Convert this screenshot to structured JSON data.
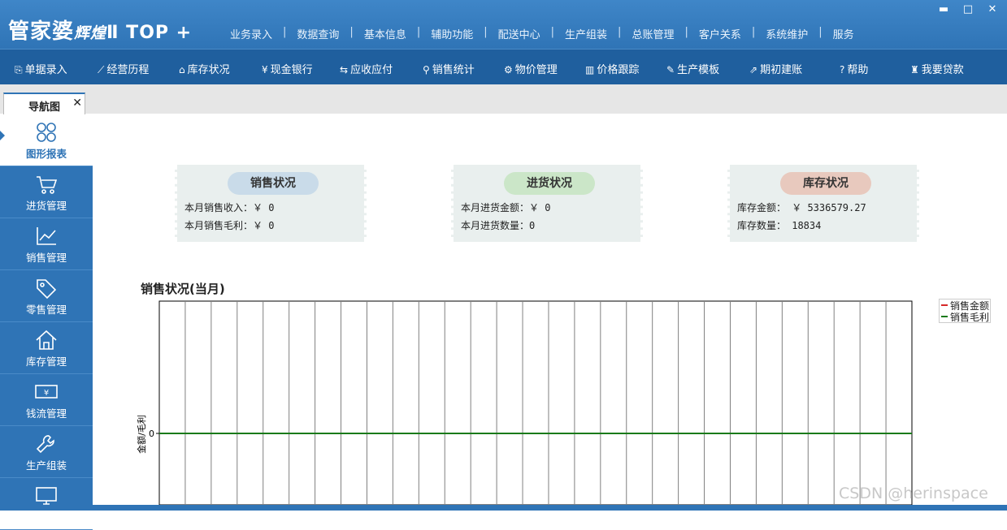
{
  "app": {
    "logo_main": "管家婆",
    "logo_sub": "辉煌",
    "logo_top": "Ⅱ TOP +"
  },
  "menu": [
    "业务录入",
    "数据查询",
    "基本信息",
    "辅助功能",
    "配送中心",
    "生产组装",
    "总账管理",
    "客户关系",
    "系统维护",
    "服务"
  ],
  "menu_separator": "|",
  "window_controls": {
    "minimize": "▬",
    "maximize": "□",
    "close": "✕"
  },
  "toolbar": [
    {
      "icon": "document-icon",
      "glyph": "⎘",
      "label": "单据录入"
    },
    {
      "icon": "trend-icon",
      "glyph": "⟋",
      "label": "经营历程"
    },
    {
      "icon": "home-icon",
      "glyph": "⌂",
      "label": "库存状况"
    },
    {
      "icon": "yen-icon",
      "glyph": "¥",
      "label": "现金银行"
    },
    {
      "icon": "swap-icon",
      "glyph": "⇆",
      "label": "应收应付"
    },
    {
      "icon": "search-icon",
      "glyph": "⚲",
      "label": "销售统计"
    },
    {
      "icon": "gear-icon",
      "glyph": "⚙",
      "label": "物价管理"
    },
    {
      "icon": "bar-chart-icon",
      "glyph": "▥",
      "label": "价格跟踪"
    },
    {
      "icon": "wrench-icon",
      "glyph": "✎",
      "label": "生产模板"
    },
    {
      "icon": "external-link-icon",
      "glyph": "⇗",
      "label": "期初建账"
    },
    {
      "icon": "help-icon",
      "glyph": "?",
      "label": "帮助"
    },
    {
      "icon": "money-bag-icon",
      "glyph": "♜",
      "label": "我要贷款"
    }
  ],
  "tabs": [
    {
      "label": "导航图",
      "close": "✕"
    }
  ],
  "sidebar": [
    {
      "label": "图形报表",
      "icon": "chart-grid-icon",
      "active": true
    },
    {
      "label": "进货管理",
      "icon": "cart-icon"
    },
    {
      "label": "销售管理",
      "icon": "line-chart-icon"
    },
    {
      "label": "零售管理",
      "icon": "tag-icon"
    },
    {
      "label": "库存管理",
      "icon": "house-icon"
    },
    {
      "label": "钱流管理",
      "icon": "cash-icon"
    },
    {
      "label": "生产组装",
      "icon": "wrench-icon"
    },
    {
      "label": "",
      "icon": "monitor-icon"
    }
  ],
  "cards": {
    "sales": {
      "title": "销售状况",
      "color": "#c9dbe9",
      "rows": [
        "本月销售收入：￥ 0",
        "本月销售毛利：￥ 0"
      ]
    },
    "purchase": {
      "title": "进货状况",
      "color": "#cbe6c8",
      "rows": [
        "本月进货金额：￥ 0",
        "本月进货数量：0"
      ]
    },
    "inventory": {
      "title": "库存状况",
      "color": "#e8c9be",
      "rows": [
        "库存金额： ￥ 5336579.27",
        "库存数量： 18834"
      ]
    }
  },
  "chart_data": {
    "type": "line",
    "title": "销售状况(当月)",
    "ylabel": "金额/毛利",
    "y_ticks": [
      "0"
    ],
    "category_count": 29,
    "series": [
      {
        "name": "销售金额",
        "color": "#d62828"
      },
      {
        "name": "销售毛利",
        "color": "#1a7a1a"
      }
    ],
    "grid": true,
    "legend": "top-right"
  },
  "watermark": "CSDN @herinspace"
}
